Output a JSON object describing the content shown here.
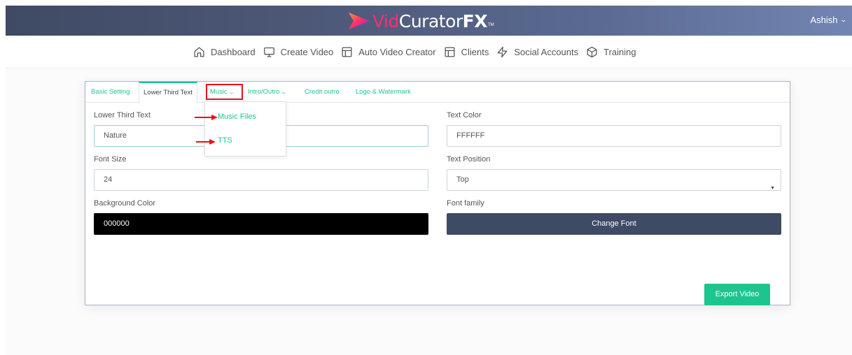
{
  "header": {
    "logo": {
      "part1": "Vid",
      "part2": "Curator",
      "part3": "FX",
      "tm": "TM"
    },
    "user_name": "Ashish",
    "user_chevron": "⌄"
  },
  "nav": {
    "items": [
      {
        "label": "Dashboard",
        "icon": "home-icon"
      },
      {
        "label": "Create Video",
        "icon": "monitor-icon"
      },
      {
        "label": "Auto Video Creator",
        "icon": "layout-icon"
      },
      {
        "label": "Clients",
        "icon": "layout-icon"
      },
      {
        "label": "Social Accounts",
        "icon": "zap-icon"
      },
      {
        "label": "Training",
        "icon": "box-icon"
      }
    ]
  },
  "tabs": {
    "basic": "Basic Setting",
    "lower_third": "Lower Third Text",
    "music": "Music",
    "intro_outro": "Intro/Outro",
    "credit_outro": "Credit outro",
    "logo_watermark": "Logo & Watermark"
  },
  "music_menu": {
    "items": [
      "Music Files",
      "TTS"
    ]
  },
  "form": {
    "lower_third_label": "Lower Third Text",
    "lower_third_value": "Nature",
    "font_size_label": "Font Size",
    "font_size_value": "24",
    "background_color_label": "Background Color",
    "background_color_value": "000000",
    "text_color_label": "Text Color",
    "text_color_value": "FFFFFF",
    "text_position_label": "Text Position",
    "text_position_value": "Top",
    "font_family_label": "Font family",
    "change_font_label": "Change Font",
    "export_label": "Export Video"
  },
  "colors": {
    "accent": "#1dc58e",
    "brand_dark": "#3f4a64",
    "annotation_red": "#e8101b",
    "logo_pink": "#ff2d6f"
  }
}
